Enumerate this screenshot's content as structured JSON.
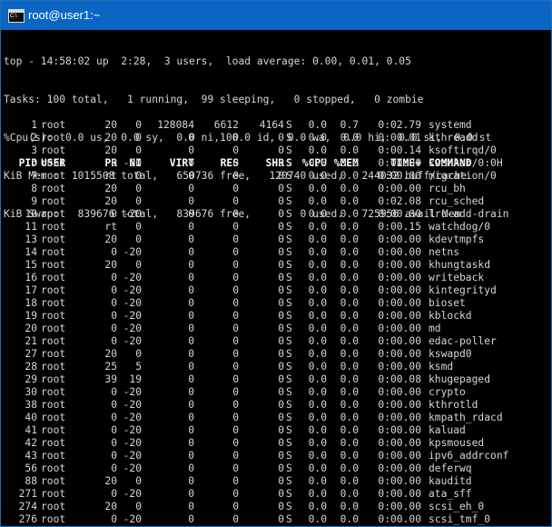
{
  "window": {
    "title": "root@user1:~",
    "icon": "console-icon"
  },
  "summary": [
    "top - 14:58:02 up  2:28,  3 users,  load average: 0.00, 0.01, 0.05",
    "Tasks: 100 total,   1 running,  99 sleeping,   0 stopped,   0 zombie",
    "%Cpu(s):  0.0 us,  0.0 sy,  0.0 ni,100.0 id,  0.0 wa,  0.0 hi,  0.0 si,  0.0 st",
    "KiB Mem :  1015508 total,   650736 free,   120740 used,   244032 buff/cache",
    "KiB Swap:   839676 total,   839676 free,        0 used.   725956 avail Mem"
  ],
  "table": {
    "columns": [
      "PID",
      "USER",
      "PR",
      "NI",
      "VIRT",
      "RES",
      "SHR",
      "S",
      "%CPU",
      "%MEM",
      "TIME+",
      "COMMAND"
    ],
    "rows": [
      [
        "1",
        "root",
        "20",
        "0",
        "128084",
        "6612",
        "4164",
        "S",
        "0.0",
        "0.7",
        "0:02.79",
        "systemd"
      ],
      [
        "2",
        "root",
        "20",
        "0",
        "0",
        "0",
        "0",
        "S",
        "0.0",
        "0.0",
        "0:00.01",
        "kthreadd"
      ],
      [
        "3",
        "root",
        "20",
        "0",
        "0",
        "0",
        "0",
        "S",
        "0.0",
        "0.0",
        "0:00.14",
        "ksoftirqd/0"
      ],
      [
        "5",
        "root",
        "0",
        "-20",
        "0",
        "0",
        "0",
        "S",
        "0.0",
        "0.0",
        "0:00.00",
        "kworker/0:0H"
      ],
      [
        "7",
        "root",
        "rt",
        "0",
        "0",
        "0",
        "0",
        "S",
        "0.0",
        "0.0",
        "0:00.00",
        "migration/0"
      ],
      [
        "8",
        "root",
        "20",
        "0",
        "0",
        "0",
        "0",
        "S",
        "0.0",
        "0.0",
        "0:00.00",
        "rcu_bh"
      ],
      [
        "9",
        "root",
        "20",
        "0",
        "0",
        "0",
        "0",
        "S",
        "0.0",
        "0.0",
        "0:02.08",
        "rcu_sched"
      ],
      [
        "10",
        "root",
        "0",
        "-20",
        "0",
        "0",
        "0",
        "S",
        "0.0",
        "0.0",
        "0:00.00",
        "lru-add-drain"
      ],
      [
        "11",
        "root",
        "rt",
        "0",
        "0",
        "0",
        "0",
        "S",
        "0.0",
        "0.0",
        "0:00.15",
        "watchdog/0"
      ],
      [
        "13",
        "root",
        "20",
        "0",
        "0",
        "0",
        "0",
        "S",
        "0.0",
        "0.0",
        "0:00.00",
        "kdevtmpfs"
      ],
      [
        "14",
        "root",
        "0",
        "-20",
        "0",
        "0",
        "0",
        "S",
        "0.0",
        "0.0",
        "0:00.00",
        "netns"
      ],
      [
        "15",
        "root",
        "20",
        "0",
        "0",
        "0",
        "0",
        "S",
        "0.0",
        "0.0",
        "0:00.00",
        "khungtaskd"
      ],
      [
        "16",
        "root",
        "0",
        "-20",
        "0",
        "0",
        "0",
        "S",
        "0.0",
        "0.0",
        "0:00.00",
        "writeback"
      ],
      [
        "17",
        "root",
        "0",
        "-20",
        "0",
        "0",
        "0",
        "S",
        "0.0",
        "0.0",
        "0:00.00",
        "kintegrityd"
      ],
      [
        "18",
        "root",
        "0",
        "-20",
        "0",
        "0",
        "0",
        "S",
        "0.0",
        "0.0",
        "0:00.00",
        "bioset"
      ],
      [
        "19",
        "root",
        "0",
        "-20",
        "0",
        "0",
        "0",
        "S",
        "0.0",
        "0.0",
        "0:00.00",
        "kblockd"
      ],
      [
        "20",
        "root",
        "0",
        "-20",
        "0",
        "0",
        "0",
        "S",
        "0.0",
        "0.0",
        "0:00.00",
        "md"
      ],
      [
        "21",
        "root",
        "0",
        "-20",
        "0",
        "0",
        "0",
        "S",
        "0.0",
        "0.0",
        "0:00.00",
        "edac-poller"
      ],
      [
        "27",
        "root",
        "20",
        "0",
        "0",
        "0",
        "0",
        "S",
        "0.0",
        "0.0",
        "0:00.00",
        "kswapd0"
      ],
      [
        "28",
        "root",
        "25",
        "5",
        "0",
        "0",
        "0",
        "S",
        "0.0",
        "0.0",
        "0:00.00",
        "ksmd"
      ],
      [
        "29",
        "root",
        "39",
        "19",
        "0",
        "0",
        "0",
        "S",
        "0.0",
        "0.0",
        "0:00.08",
        "khugepaged"
      ],
      [
        "30",
        "root",
        "0",
        "-20",
        "0",
        "0",
        "0",
        "S",
        "0.0",
        "0.0",
        "0:00.00",
        "crypto"
      ],
      [
        "38",
        "root",
        "0",
        "-20",
        "0",
        "0",
        "0",
        "S",
        "0.0",
        "0.0",
        "0:00.00",
        "kthrotld"
      ],
      [
        "40",
        "root",
        "0",
        "-20",
        "0",
        "0",
        "0",
        "S",
        "0.0",
        "0.0",
        "0:00.00",
        "kmpath_rdacd"
      ],
      [
        "41",
        "root",
        "0",
        "-20",
        "0",
        "0",
        "0",
        "S",
        "0.0",
        "0.0",
        "0:00.00",
        "kaluad"
      ],
      [
        "42",
        "root",
        "0",
        "-20",
        "0",
        "0",
        "0",
        "S",
        "0.0",
        "0.0",
        "0:00.00",
        "kpsmoused"
      ],
      [
        "43",
        "root",
        "0",
        "-20",
        "0",
        "0",
        "0",
        "S",
        "0.0",
        "0.0",
        "0:00.00",
        "ipv6_addrconf"
      ],
      [
        "56",
        "root",
        "0",
        "-20",
        "0",
        "0",
        "0",
        "S",
        "0.0",
        "0.0",
        "0:00.00",
        "deferwq"
      ],
      [
        "88",
        "root",
        "20",
        "0",
        "0",
        "0",
        "0",
        "S",
        "0.0",
        "0.0",
        "0:00.00",
        "kauditd"
      ],
      [
        "271",
        "root",
        "0",
        "-20",
        "0",
        "0",
        "0",
        "S",
        "0.0",
        "0.0",
        "0:00.00",
        "ata_sff"
      ],
      [
        "274",
        "root",
        "20",
        "0",
        "0",
        "0",
        "0",
        "S",
        "0.0",
        "0.0",
        "0:00.00",
        "scsi_eh_0"
      ],
      [
        "276",
        "root",
        "0",
        "-20",
        "0",
        "0",
        "0",
        "S",
        "0.0",
        "0.0",
        "0:00.00",
        "scsi_tmf_0"
      ]
    ]
  }
}
